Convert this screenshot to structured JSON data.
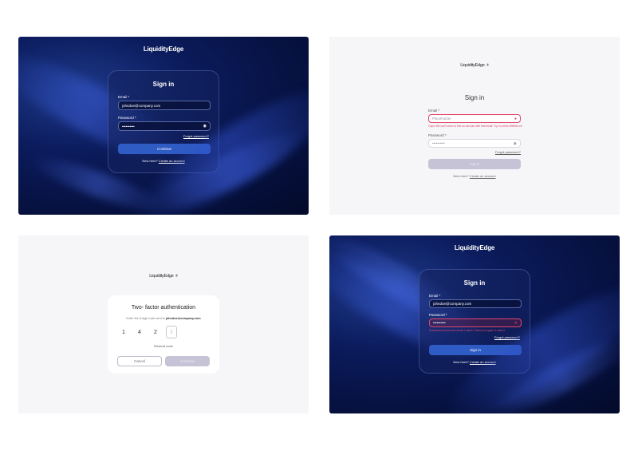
{
  "brand": {
    "logo": "LiquidityEdge",
    "mark": "®"
  },
  "panel1": {
    "title": "Sign in",
    "email_label": "Email *",
    "email_value": "johndoe@company.com",
    "password_label": "Password *",
    "password_value": "••••••••••",
    "forgot": "Forgot password?",
    "continue": "Continue",
    "new_here": "New here?",
    "create": "Create an account"
  },
  "panel2": {
    "title": "Sign in",
    "email_label": "Email *",
    "email_placeholder": "Placeholder",
    "email_error": "Oops! We can't seem to find an account with that email. Try a correct different email.",
    "password_label": "Password *",
    "password_value": "••••••••••",
    "forgot": "Forgot password?",
    "login": "Log in",
    "new_here": "New here?",
    "create": "Create an account"
  },
  "panel3": {
    "title": "Two- factor authentication",
    "instruction": "Enter the 6-digit code sent to",
    "email": "johndoe@company.com",
    "digits": [
      "1",
      "4",
      "2",
      "|",
      "",
      ""
    ],
    "resend": "Resend code",
    "cancel": "Cancel",
    "continue": "Continue"
  },
  "panel4": {
    "title": "Sign in",
    "email_label": "Email *",
    "email_value": "johndoe@company.com",
    "password_label": "Password *",
    "password_value": "••••••••••",
    "password_error": "Password and account doesn't match. Please try again or reset it.",
    "forgot": "Forgot password?",
    "signin": "Sign in",
    "new_here": "New here?",
    "create": "Create an account"
  }
}
